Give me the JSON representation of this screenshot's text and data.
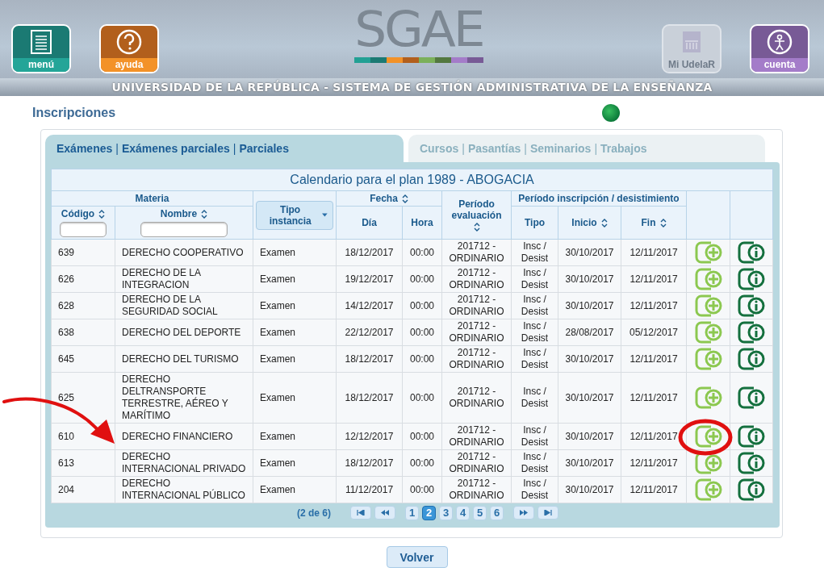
{
  "header": {
    "logo": "SGAE",
    "buttons": [
      {
        "kind": "menu",
        "label": "menú",
        "disabled": false
      },
      {
        "kind": "help",
        "label": "ayuda",
        "disabled": false
      },
      {
        "kind": "home",
        "label": "Mi UdelaR",
        "disabled": true
      },
      {
        "kind": "account",
        "label": "cuenta",
        "disabled": false
      }
    ],
    "banner": "UNIVERSIDAD DE LA REPÚBLICA - SISTEMA DE GESTIÓN ADMINISTRATIVA DE LA ENSEÑANZA"
  },
  "page_title": "Inscripciones",
  "tabs": [
    {
      "selected": true,
      "separator": "|",
      "links": [
        "Exámenes",
        "Exámenes parciales",
        "Parciales"
      ]
    },
    {
      "selected": false,
      "separator": "|",
      "links": [
        "Cursos",
        "Pasantías",
        "Seminarios",
        "Trabajos"
      ]
    }
  ],
  "table": {
    "title": "Calendario para el plan 1989 - ABOGACIA",
    "columns": {
      "materia": "Materia",
      "codigo": "Código",
      "nombre": "Nombre",
      "tipo_instancia": "Tipo instancia",
      "fecha": "Fecha",
      "dia": "Día",
      "hora": "Hora",
      "periodo_evaluacion": "Período evaluación",
      "periodo_inscripcion": "Período inscripción / desistimiento",
      "tipo": "Tipo",
      "inicio": "Inicio",
      "fin": "Fin"
    },
    "rows": [
      {
        "codigo": "639",
        "nombre": "DERECHO COOPERATIVO",
        "tipo_instancia": "Examen",
        "dia": "18/12/2017",
        "hora": "00:00",
        "periodo": "201712 - ORDINARIO",
        "tipo": "Insc / Desist",
        "inicio": "30/10/2017",
        "fin": "12/11/2017"
      },
      {
        "codigo": "626",
        "nombre": "DERECHO DE LA INTEGRACION",
        "tipo_instancia": "Examen",
        "dia": "19/12/2017",
        "hora": "00:00",
        "periodo": "201712 - ORDINARIO",
        "tipo": "Insc / Desist",
        "inicio": "30/10/2017",
        "fin": "12/11/2017"
      },
      {
        "codigo": "628",
        "nombre": "DERECHO DE LA SEGURIDAD SOCIAL",
        "tipo_instancia": "Examen",
        "dia": "14/12/2017",
        "hora": "00:00",
        "periodo": "201712 - ORDINARIO",
        "tipo": "Insc / Desist",
        "inicio": "30/10/2017",
        "fin": "12/11/2017"
      },
      {
        "codigo": "638",
        "nombre": "DERECHO DEL DEPORTE",
        "tipo_instancia": "Examen",
        "dia": "22/12/2017",
        "hora": "00:00",
        "periodo": "201712 - ORDINARIO",
        "tipo": "Insc / Desist",
        "inicio": "28/08/2017",
        "fin": "05/12/2017"
      },
      {
        "codigo": "645",
        "nombre": "DERECHO DEL TURISMO",
        "tipo_instancia": "Examen",
        "dia": "18/12/2017",
        "hora": "00:00",
        "periodo": "201712 - ORDINARIO",
        "tipo": "Insc / Desist",
        "inicio": "30/10/2017",
        "fin": "12/11/2017"
      },
      {
        "codigo": "625",
        "nombre": "DERECHO DELTRANSPORTE TERRESTRE, AÉREO Y MARÍTIMO",
        "tipo_instancia": "Examen",
        "dia": "18/12/2017",
        "hora": "00:00",
        "periodo": "201712 - ORDINARIO",
        "tipo": "Insc / Desist",
        "inicio": "30/10/2017",
        "fin": "12/11/2017"
      },
      {
        "codigo": "610",
        "nombre": "DERECHO FINANCIERO",
        "tipo_instancia": "Examen",
        "dia": "12/12/2017",
        "hora": "00:00",
        "periodo": "201712 - ORDINARIO",
        "tipo": "Insc / Desist",
        "inicio": "30/10/2017",
        "fin": "12/11/2017"
      },
      {
        "codigo": "613",
        "nombre": "DERECHO INTERNACIONAL PRIVADO",
        "tipo_instancia": "Examen",
        "dia": "18/12/2017",
        "hora": "00:00",
        "periodo": "201712 - ORDINARIO",
        "tipo": "Insc / Desist",
        "inicio": "30/10/2017",
        "fin": "12/11/2017"
      },
      {
        "codigo": "204",
        "nombre": "DERECHO INTERNACIONAL PÚBLICO",
        "tipo_instancia": "Examen",
        "dia": "11/12/2017",
        "hora": "00:00",
        "periodo": "201712 - ORDINARIO",
        "tipo": "Insc / Desist",
        "inicio": "30/10/2017",
        "fin": "12/11/2017"
      }
    ]
  },
  "pagination": {
    "summary": "(2 de 6)",
    "pages": [
      {
        "label": "1",
        "selected": false
      },
      {
        "label": "2",
        "selected": true
      },
      {
        "label": "3",
        "selected": false
      },
      {
        "label": "4",
        "selected": false
      },
      {
        "label": "5",
        "selected": false
      },
      {
        "label": "6",
        "selected": false
      }
    ]
  },
  "back_button": "Volver"
}
